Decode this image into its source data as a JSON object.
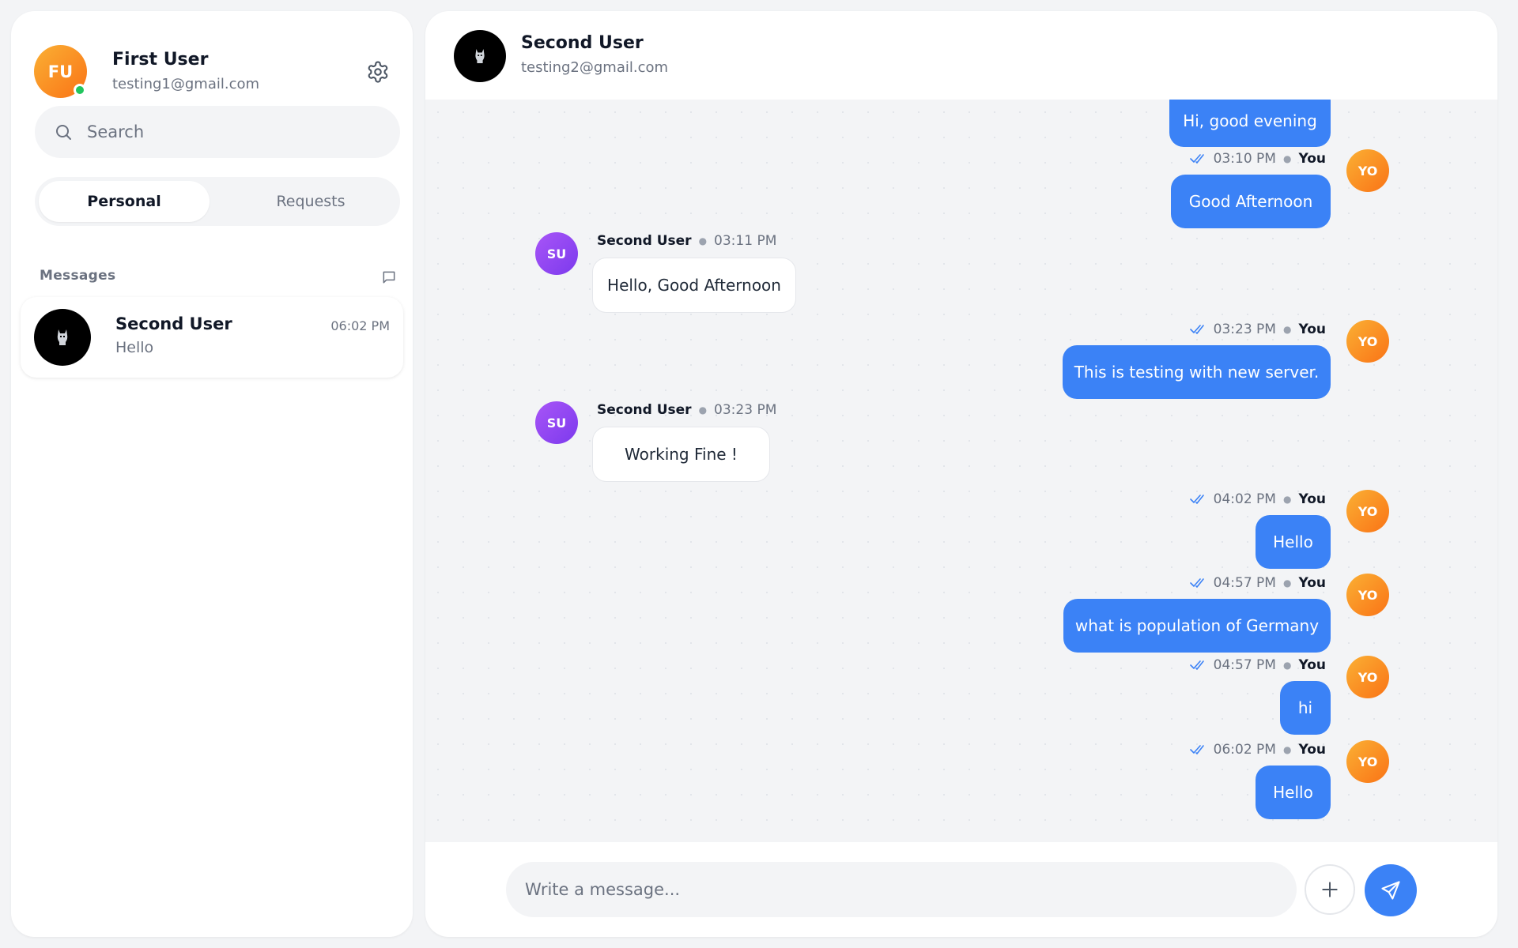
{
  "colors": {
    "accent": "#3b82f6",
    "online": "#22c55e",
    "avatar_self": "#f97316",
    "avatar_other": "#8b5cf6"
  },
  "current_user": {
    "initials": "FU",
    "name": "First User",
    "email": "testing1@gmail.com",
    "status": "online"
  },
  "sidebar": {
    "search_placeholder": "Search",
    "tabs": [
      {
        "label": "Personal",
        "active": true
      },
      {
        "label": "Requests",
        "active": false
      }
    ],
    "section_label": "Messages",
    "conversations": [
      {
        "name": "Second User",
        "time": "06:02 PM",
        "preview": "Hello"
      }
    ]
  },
  "chat": {
    "contact_name": "Second User",
    "contact_email": "testing2@gmail.com",
    "you_label": "You",
    "self_initials": "YO",
    "other_initials": "SU",
    "messages": [
      {
        "direction": "out",
        "text": "Hi, good evening"
      },
      {
        "direction": "out",
        "time": "03:10 PM",
        "sender": "You",
        "text": "Good Afternoon"
      },
      {
        "direction": "in",
        "time": "03:11 PM",
        "sender": "Second User",
        "text": "Hello, Good Afternoon"
      },
      {
        "direction": "out",
        "time": "03:23 PM",
        "sender": "You",
        "text": "This is testing with new server."
      },
      {
        "direction": "in",
        "time": "03:23 PM",
        "sender": "Second User",
        "text": "Working Fine !"
      },
      {
        "direction": "out",
        "time": "04:02 PM",
        "sender": "You",
        "text": "Hello"
      },
      {
        "direction": "out",
        "time": "04:57 PM",
        "sender": "You",
        "text": "what is population of Germany"
      },
      {
        "direction": "out",
        "time": "04:57 PM",
        "sender": "You",
        "text": "hi"
      },
      {
        "direction": "out",
        "time": "06:02 PM",
        "sender": "You",
        "text": "Hello"
      }
    ],
    "composer_placeholder": "Write a message..."
  }
}
